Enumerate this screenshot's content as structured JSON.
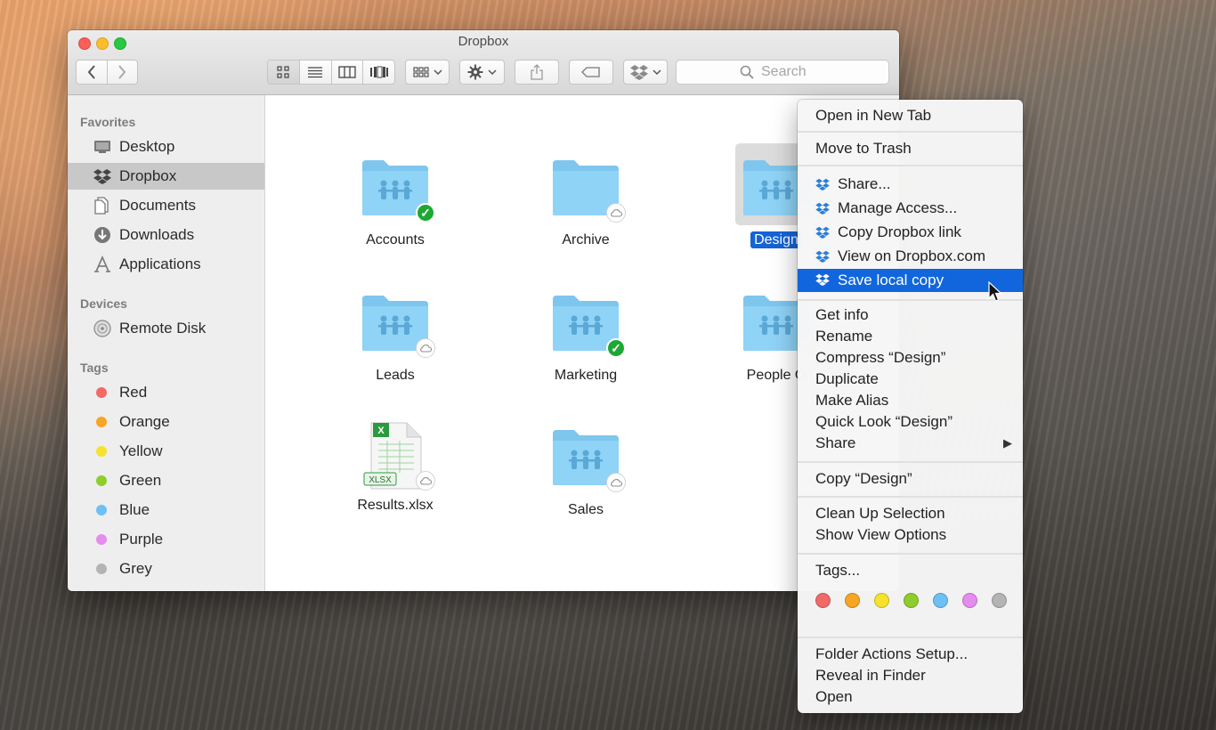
{
  "window": {
    "title": "Dropbox",
    "search_placeholder": "Search"
  },
  "sidebar": {
    "favorites_heading": "Favorites",
    "favorites": [
      {
        "label": "Desktop",
        "icon": "desktop-icon"
      },
      {
        "label": "Dropbox",
        "icon": "dropbox-icon",
        "selected": true
      },
      {
        "label": "Documents",
        "icon": "documents-icon"
      },
      {
        "label": "Downloads",
        "icon": "downloads-icon"
      },
      {
        "label": "Applications",
        "icon": "applications-icon"
      }
    ],
    "devices_heading": "Devices",
    "devices": [
      {
        "label": "Remote Disk",
        "icon": "disk-icon"
      }
    ],
    "tags_heading": "Tags",
    "tags": [
      {
        "label": "Red",
        "color": "#f16a67"
      },
      {
        "label": "Orange",
        "color": "#f6a623"
      },
      {
        "label": "Yellow",
        "color": "#f6e22d"
      },
      {
        "label": "Green",
        "color": "#8fcd2c"
      },
      {
        "label": "Blue",
        "color": "#6cc0f5"
      },
      {
        "label": "Purple",
        "color": "#e58cef"
      },
      {
        "label": "Grey",
        "color": "#b4b4b4"
      }
    ]
  },
  "files": [
    {
      "name": "Accounts",
      "kind": "shared-folder",
      "status": "synced"
    },
    {
      "name": "Archive",
      "kind": "folder",
      "status": "online-only"
    },
    {
      "name": "Design",
      "kind": "shared-folder",
      "status": "online-only",
      "selected": true
    },
    {
      "name": "Leads",
      "kind": "shared-folder",
      "status": "online-only"
    },
    {
      "name": "Marketing",
      "kind": "shared-folder",
      "status": "synced"
    },
    {
      "name": "People O",
      "kind": "shared-folder",
      "status": "online-only"
    },
    {
      "name": "Results.xlsx",
      "kind": "xlsx",
      "status": "online-only",
      "file_badge": "XLSX"
    },
    {
      "name": "Sales",
      "kind": "shared-folder",
      "status": "online-only"
    }
  ],
  "context_menu": {
    "open_new_tab": "Open in New Tab",
    "move_to_trash": "Move to Trash",
    "dropbox_items": [
      "Share...",
      "Manage Access...",
      "Copy Dropbox link",
      "View on Dropbox.com",
      "Save local copy"
    ],
    "highlighted": "Save local copy",
    "group_info": [
      "Get info",
      "Rename",
      "Compress “Design”",
      "Duplicate",
      "Make Alias",
      "Quick Look “Design”",
      "Share"
    ],
    "copy_item": "Copy “Design”",
    "view_items": [
      "Clean Up Selection",
      "Show View Options"
    ],
    "tags_label": "Tags...",
    "tag_colors": [
      "#f16a67",
      "#f6a623",
      "#f6e22d",
      "#8fcd2c",
      "#6cc0f5",
      "#e58cef",
      "#b4b4b4"
    ],
    "bottom_items": [
      "Folder Actions Setup...",
      "Reveal in Finder",
      "Open"
    ]
  }
}
